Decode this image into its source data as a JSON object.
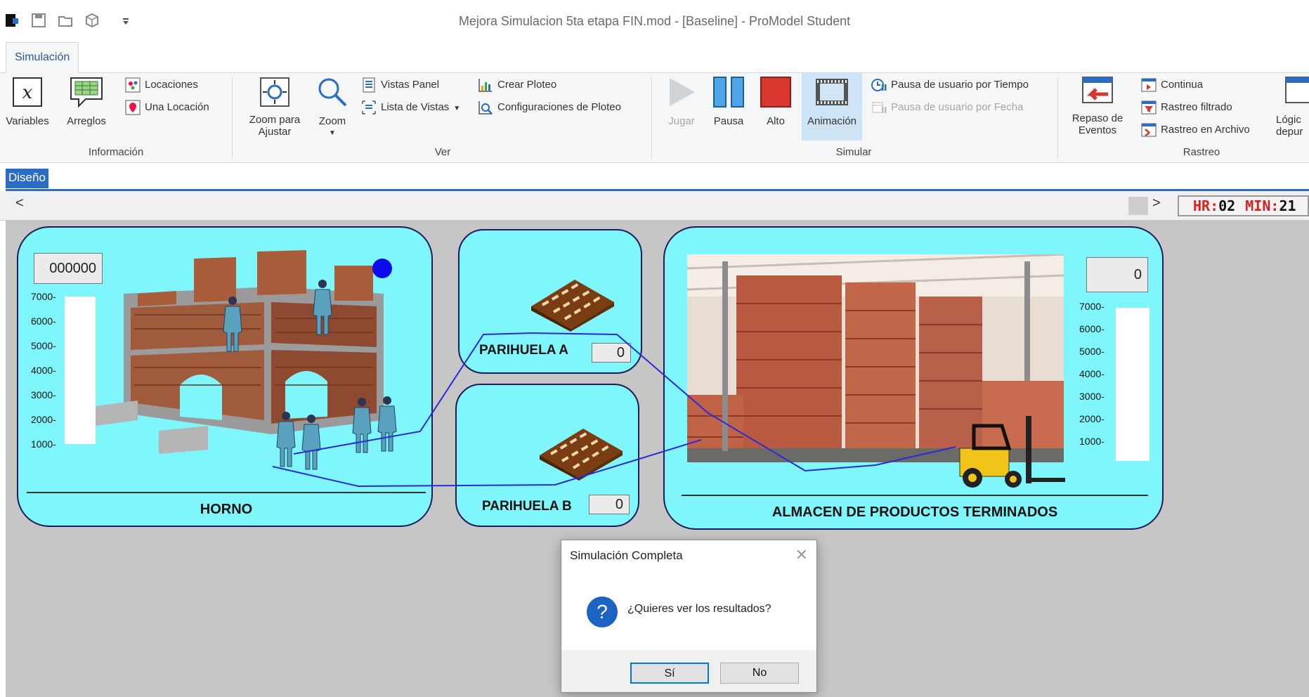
{
  "window": {
    "title": "Mejora Simulacion 5ta etapa FIN.mod - [Baseline] - ProModel Student"
  },
  "ribbon": {
    "active_tab": "Simulación",
    "groups": {
      "informacion": {
        "label": "Información",
        "variables": "Variables",
        "arreglos": "Arreglos",
        "locaciones": "Locaciones",
        "una_locacion": "Una Locación"
      },
      "ver": {
        "label": "Ver",
        "zoom_ajustar": "Zoom para Ajustar",
        "zoom": "Zoom",
        "vistas_panel": "Vistas Panel",
        "lista_vistas": "Lista de Vistas",
        "crear_ploteo": "Crear Ploteo",
        "config_ploteo": "Configuraciones de Ploteo"
      },
      "simular": {
        "label": "Simular",
        "jugar": "Jugar",
        "pausa": "Pausa",
        "alto": "Alto",
        "animacion": "Animación",
        "pausa_tiempo": "Pausa de usuario por Tiempo",
        "pausa_fecha": "Pausa de usuario por Fecha"
      },
      "rastreo": {
        "label": "Rastreo",
        "repaso": "Repaso de Eventos",
        "continua": "Continua",
        "rastreo_filtrado": "Rastreo filtrado",
        "rastreo_archivo": "Rastreo en Archivo",
        "logica": "Lógic depur"
      }
    }
  },
  "design_tab": "Diseño",
  "scroll": {
    "left_arrow": "<",
    "right_arrow": ">"
  },
  "clock": {
    "hr_label": "HR:",
    "hr_value": "02",
    "min_label": "MIN:",
    "min_value": "21"
  },
  "colors": {
    "panel": "#7ff6fb",
    "canvas": "#c6c6c6",
    "accent": "#2b6cc4",
    "clock_label": "#e11d1d"
  },
  "locations": {
    "horno": {
      "label": "HORNO",
      "counter": "000000",
      "ticks": [
        "7000-",
        "6000-",
        "5000-",
        "4000-",
        "3000-",
        "2000-",
        "1000-"
      ]
    },
    "parihuela_a": {
      "label": "PARIHUELA A",
      "counter": "0"
    },
    "parihuela_b": {
      "label": "PARIHUELA B",
      "counter": "0"
    },
    "almacen": {
      "label": "ALMACEN DE PRODUCTOS TERMINADOS",
      "counter": "0",
      "ticks": [
        "7000-",
        "6000-",
        "5000-",
        "4000-",
        "3000-",
        "2000-",
        "1000-"
      ]
    }
  },
  "dialog": {
    "title": "Simulación Completa",
    "close": "✕",
    "message": "¿Quieres ver los resultados?",
    "icon_glyph": "?",
    "yes": "Sí",
    "no": "No"
  }
}
